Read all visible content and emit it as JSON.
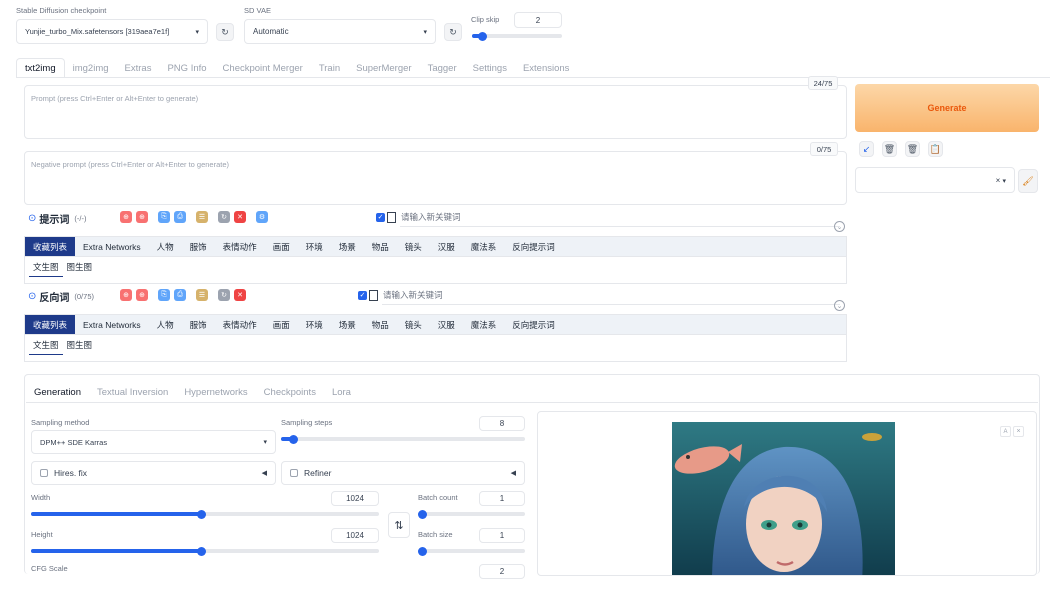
{
  "header": {
    "checkpoint_label": "Stable Diffusion checkpoint",
    "checkpoint_value": "Yunjie_turbo_Mix.safetensors [319aea7e1f]",
    "vae_label": "SD VAE",
    "vae_value": "Automatic",
    "clip_skip_label": "Clip skip",
    "clip_skip_value": "2",
    "clip_skip_fraction": 0.12
  },
  "tabs": [
    "txt2img",
    "img2img",
    "Extras",
    "PNG Info",
    "Checkpoint Merger",
    "Train",
    "SuperMerger",
    "Tagger",
    "Settings",
    "Extensions"
  ],
  "prompt": {
    "placeholder": "Prompt (press Ctrl+Enter or Alt+Enter to generate)",
    "counter": "24/75",
    "neg_placeholder": "Negative prompt (press Ctrl+Enter or Alt+Enter to generate)",
    "neg_counter": "0/75"
  },
  "generate_label": "Generate",
  "styles_clear": "×",
  "prompt_helper": {
    "title": "提示词",
    "count": "(-/-)",
    "new_keyword_placeholder": "请输入新关键词",
    "categories": [
      "收藏列表",
      "Extra Networks",
      "人物",
      "服饰",
      "表情动作",
      "画面",
      "环境",
      "场景",
      "物品",
      "镜头",
      "汉服",
      "魔法系",
      "反向提示词"
    ],
    "subcategories": [
      "文生图",
      "图生图"
    ]
  },
  "neg_helper": {
    "title": "反向词",
    "count": "(0/75)",
    "new_keyword_placeholder": "请输入新关键词",
    "categories": [
      "收藏列表",
      "Extra Networks",
      "人物",
      "服饰",
      "表情动作",
      "画面",
      "环境",
      "场景",
      "物品",
      "镜头",
      "汉服",
      "魔法系",
      "反向提示词"
    ],
    "subcategories": [
      "文生图",
      "图生图"
    ]
  },
  "gen_tabs": [
    "Generation",
    "Textual Inversion",
    "Hypernetworks",
    "Checkpoints",
    "Lora"
  ],
  "generation": {
    "sampling_method_label": "Sampling method",
    "sampling_method_value": "DPM++ SDE Karras",
    "sampling_steps_label": "Sampling steps",
    "sampling_steps_value": "8",
    "sampling_steps_fraction": 0.05,
    "hires_label": "Hires. fix",
    "refiner_label": "Refiner",
    "width_label": "Width",
    "width_value": "1024",
    "width_fraction": 0.49,
    "height_label": "Height",
    "height_value": "1024",
    "height_fraction": 0.49,
    "swap_icon": "⇅",
    "batch_count_label": "Batch count",
    "batch_count_value": "1",
    "batch_count_fraction": 0.0,
    "batch_size_label": "Batch size",
    "batch_size_value": "1",
    "batch_size_fraction": 0.0,
    "cfg_label": "CFG Scale",
    "cfg_value": "2"
  },
  "colors": {
    "accent": "#2563eb",
    "generate_bg": "#fbbf78",
    "category_active": "#1e3a8a"
  }
}
